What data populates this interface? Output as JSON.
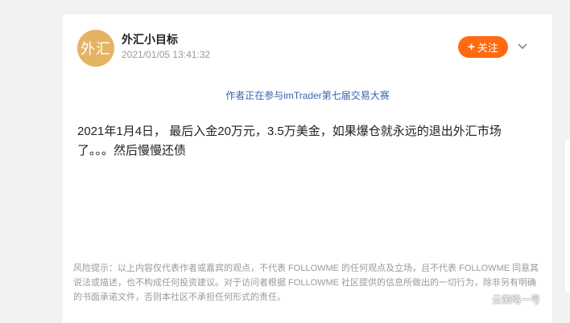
{
  "author": {
    "avatar_text": "外汇",
    "name": "外汇小目标",
    "time": "2021/01/05 13:41:32"
  },
  "follow": {
    "plus": "+",
    "label": "关注"
  },
  "contest_note": "作者正在参与imTrader第七届交易大赛",
  "post_text": "2021年1月4日， 最后入金20万元，3.5万美金，如果爆仓就永远的退出外汇市场了。。。然后慢慢还债",
  "disclaimer": "风险提示：以上内容仅代表作者或嘉宾的观点，不代表 FOLLOWME 的任何观点及立场，且不代表 FOLLOWME 同意其说法或描述，也不构成任何投资建议。对于访问者根据 FOLLOWME 社区提供的信息所做出的一切行为，除非另有明确的书面承诺文件，否则本社区不承担任何形式的责任。",
  "watermark": "云策略一号",
  "colors": {
    "accent": "#ff6a13",
    "avatar": "#e3b463",
    "link": "#3a62a8"
  },
  "icons": {
    "more": "chevron-down-icon",
    "watermark": "wechat-logo-icon"
  }
}
